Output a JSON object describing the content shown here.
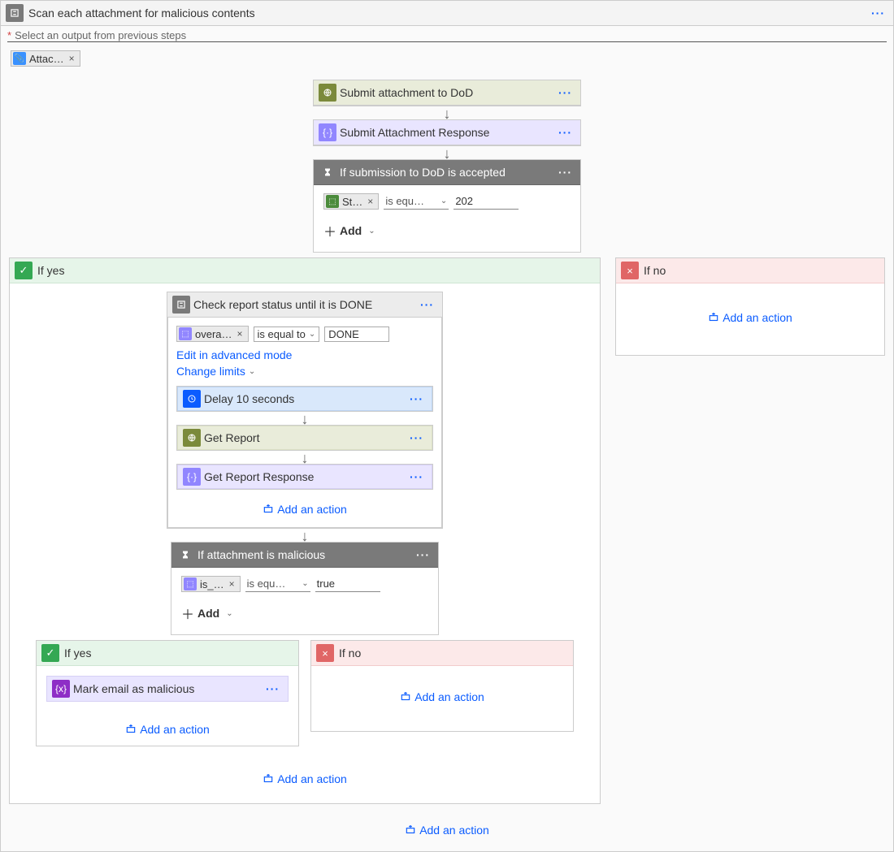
{
  "header": {
    "title": "Scan each attachment for malicious contents",
    "hint": "Select an output from previous steps",
    "token": "Attac…"
  },
  "steps": {
    "submit_dod": "Submit attachment to DoD",
    "submit_resp": "Submit Attachment Response",
    "cond_accept": {
      "title": "If submission to DoD is accepted",
      "token": "St…",
      "op": "is equ…",
      "value": "202",
      "add": "Add"
    }
  },
  "branch1": {
    "yes": "If yes",
    "no": "If no"
  },
  "do_until": {
    "title": "Check report status until it is DONE",
    "token": "overa…",
    "op": "is equal to",
    "value": "DONE",
    "link_adv": "Edit in advanced mode",
    "link_limits": "Change limits",
    "delay": "Delay 10 seconds",
    "get": "Get Report",
    "resp": "Get Report Response"
  },
  "cond_mal": {
    "title": "If attachment is malicious",
    "token": "is_…",
    "op": "is equ…",
    "value": "true",
    "add": "Add"
  },
  "branch2": {
    "yes": "If yes",
    "no": "If no",
    "mark": "Mark email as malicious"
  },
  "common": {
    "add_action": "Add an action"
  }
}
